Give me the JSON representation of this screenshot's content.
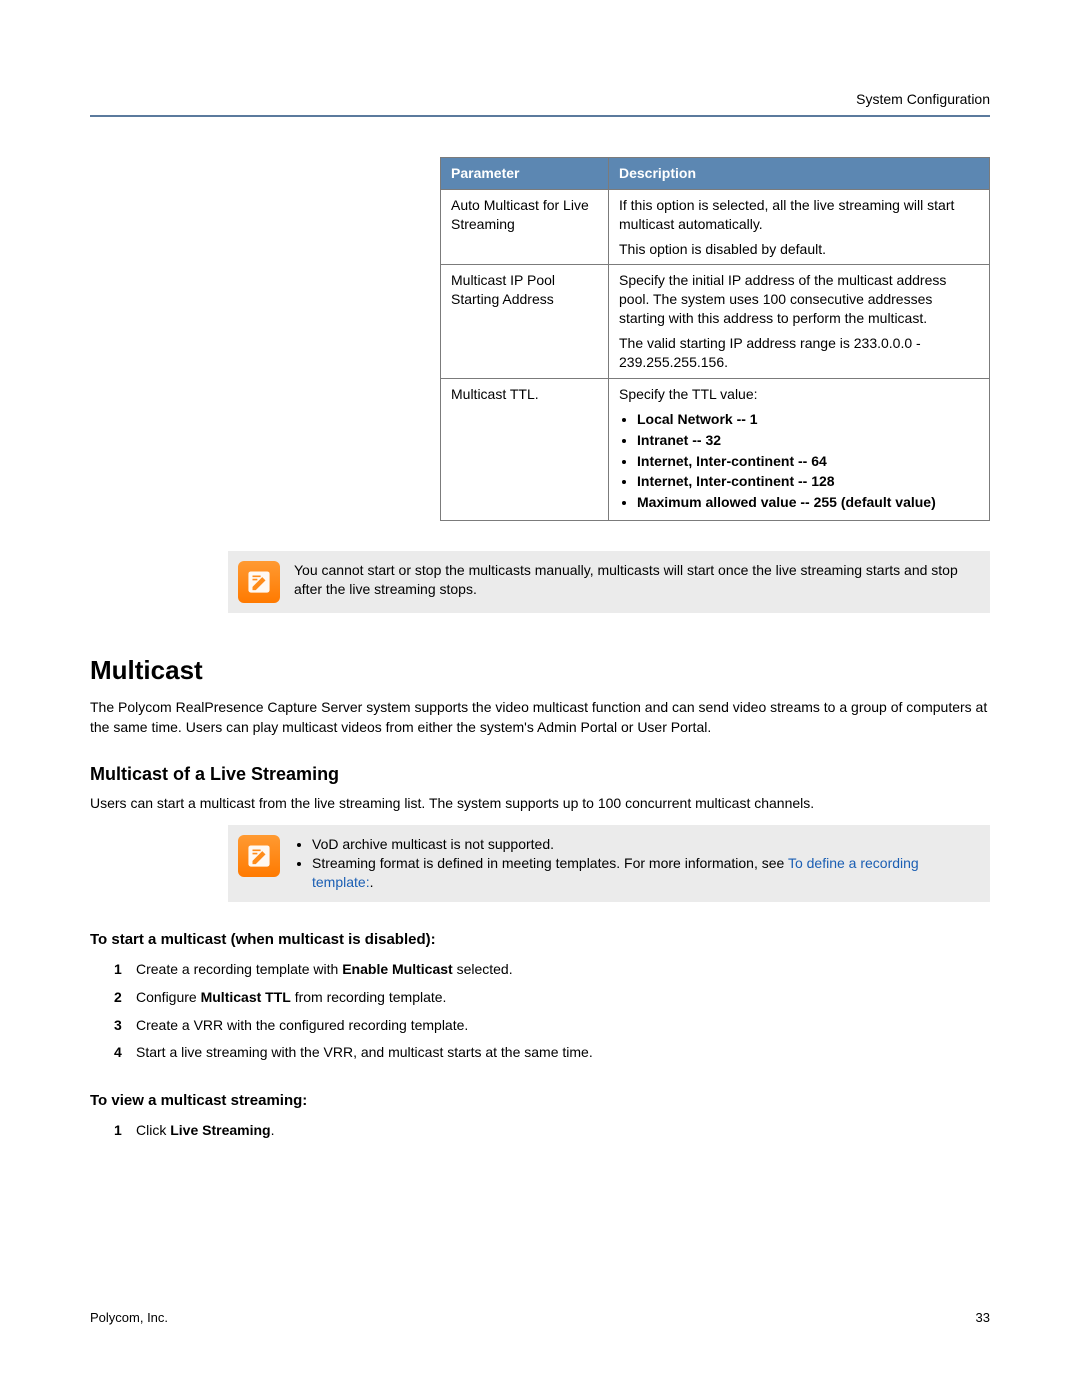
{
  "header": {
    "title": "System Configuration"
  },
  "table": {
    "headers": {
      "param": "Parameter",
      "desc": "Description"
    },
    "rows": [
      {
        "param": "Auto Multicast for Live Streaming",
        "desc_p1": "If this option is selected, all the live streaming will start multicast automatically.",
        "desc_p2": "This option is disabled by default."
      },
      {
        "param": "Multicast IP Pool Starting Address",
        "desc_p1": "Specify the initial IP address of the multicast address pool. The system uses 100 consecutive addresses starting with this address to perform the multicast.",
        "desc_p2": "The valid starting IP address range is 233.0.0.0 - 239.255.255.156."
      },
      {
        "param": "Multicast TTL.",
        "desc_intro": "Specify the TTL value:",
        "items": [
          "Local Network -- 1",
          "Intranet -- 32",
          "Internet, Inter-continent -- 64",
          "Internet, Inter-continent -- 128",
          "Maximum allowed value -- 255 (default value)"
        ]
      }
    ]
  },
  "note1": {
    "text": "You cannot start or stop the multicasts manually, multicasts will start once the live streaming starts and stop after the live streaming stops."
  },
  "multicast": {
    "heading": "Multicast",
    "intro": "The Polycom RealPresence Capture Server system supports the video multicast function and can send video streams to a group of computers at the same time. Users can play multicast videos from either the system's Admin Portal or User Portal.",
    "sub1_heading": "Multicast of a Live Streaming",
    "sub1_body": "Users can start a multicast from the live streaming list. The system supports up to 100 concurrent multicast channels."
  },
  "note2": {
    "bul1": "VoD archive multicast is not supported.",
    "bul2_a": "Streaming format is defined in meeting templates. For more information, see ",
    "bul2_link": "To define a recording template:",
    "bul2_b": "."
  },
  "proc1": {
    "heading": "To start a multicast (when multicast is disabled):",
    "steps": {
      "s1a": "Create a recording template with ",
      "s1b": "Enable Multicast",
      "s1c": " selected.",
      "s2a": "Configure ",
      "s2b": "Multicast TTL",
      "s2c": " from recording template.",
      "s3": "Create a VRR with the configured recording template.",
      "s4": "Start a live streaming with the VRR, and multicast starts at the same time."
    }
  },
  "proc2": {
    "heading": "To view a multicast streaming:",
    "s1a": "Click ",
    "s1b": "Live Streaming",
    "s1c": "."
  },
  "footer": {
    "left": "Polycom, Inc.",
    "right": "33"
  }
}
